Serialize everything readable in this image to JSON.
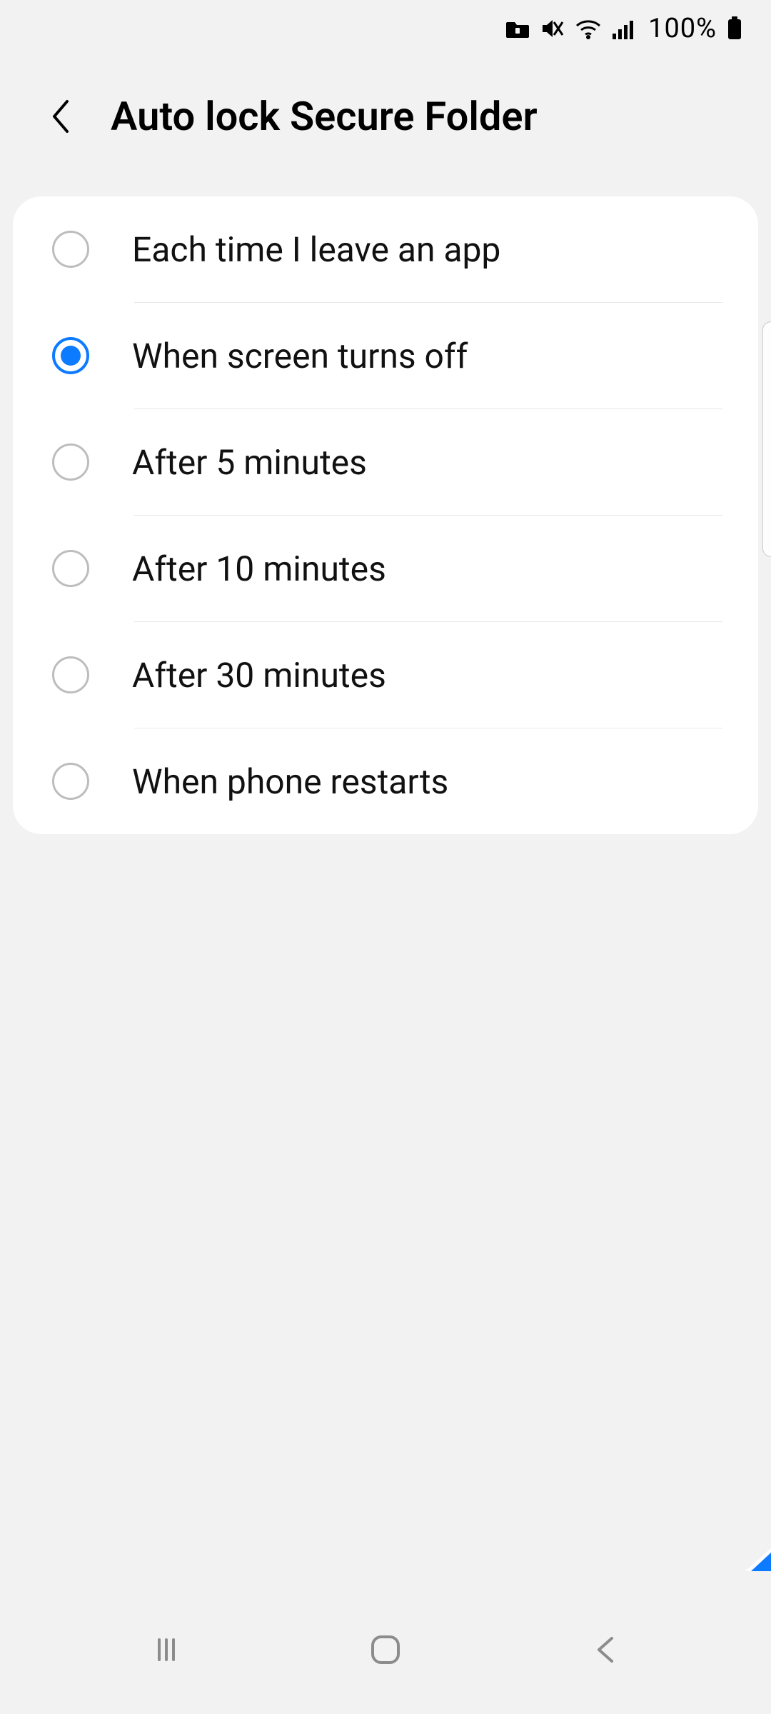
{
  "status_bar": {
    "battery_text": "100%",
    "icons": [
      "secure-folder-icon",
      "mute-icon",
      "wifi-icon",
      "signal-icon",
      "battery-icon"
    ]
  },
  "header": {
    "title": "Auto lock Secure Folder"
  },
  "options": [
    {
      "label": "Each time I leave an app",
      "selected": false
    },
    {
      "label": "When screen turns off",
      "selected": true
    },
    {
      "label": "After 5 minutes",
      "selected": false
    },
    {
      "label": "After 10 minutes",
      "selected": false
    },
    {
      "label": "After 30 minutes",
      "selected": false
    },
    {
      "label": "When phone restarts",
      "selected": false
    }
  ],
  "colors": {
    "accent": "#0d7bff",
    "background": "#f2f2f2",
    "card": "#ffffff",
    "divider": "#e7e7e7",
    "radio_border": "#bdbdbd",
    "text": "#111111"
  }
}
